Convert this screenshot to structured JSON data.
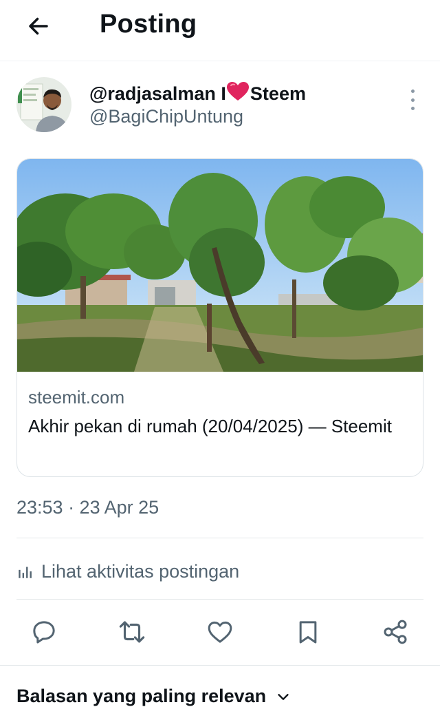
{
  "header": {
    "title": "Posting",
    "back_icon": "arrow-left-icon"
  },
  "author": {
    "display_name_prefix": "@radjasalman I",
    "display_name_suffix": "Steem",
    "heart_icon": "heart-emoji-icon",
    "heart_color": "#e0245e",
    "handle": "@BagiChipUntung"
  },
  "link_card": {
    "domain": "steemit.com",
    "title": "Akhir pekan di rumah (20/04/2025) — Steemit"
  },
  "timestamp": "23:53 · 23 Apr 25",
  "activity": {
    "label": "Lihat aktivitas postingan",
    "icon": "bar-chart-icon"
  },
  "actions": [
    "reply-icon",
    "retweet-icon",
    "like-icon",
    "bookmark-icon",
    "share-icon"
  ],
  "replies_sort": {
    "label": "Balasan yang paling relevan",
    "icon": "chevron-down-icon"
  },
  "colors": {
    "text": "#0f1419",
    "secondary": "#536471",
    "border": "#dde3e7"
  }
}
